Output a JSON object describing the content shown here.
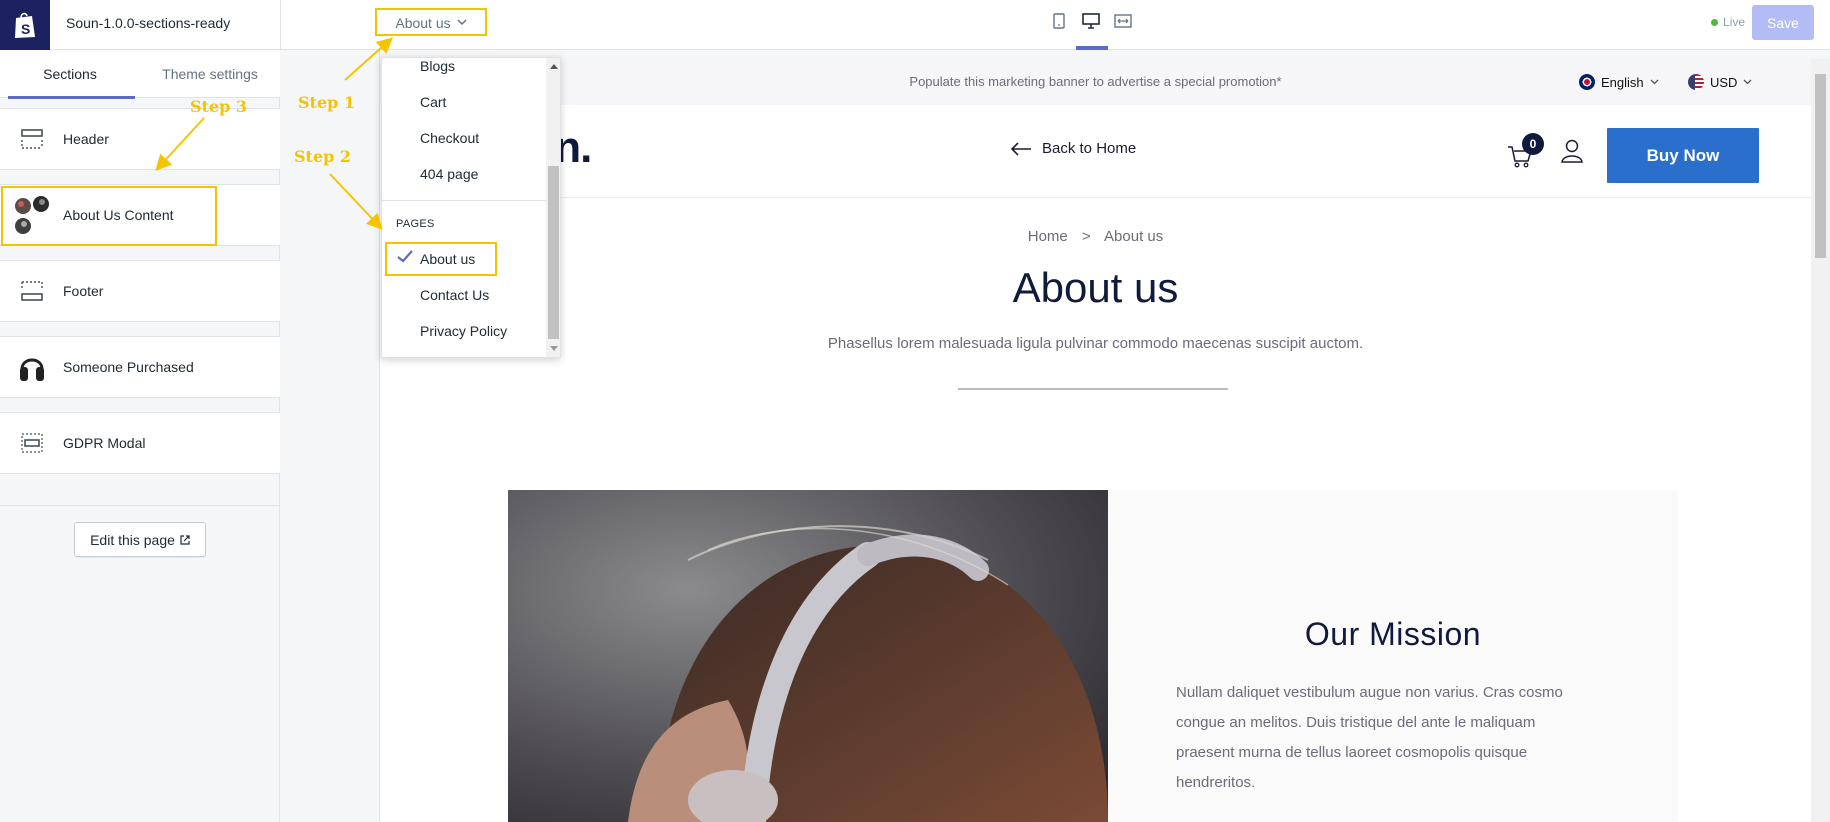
{
  "topbar": {
    "store_name": "Soun-1.0.0-sections-ready",
    "page_select": "About us",
    "live_label": "Live",
    "save_label": "Save"
  },
  "sidebar": {
    "tabs": [
      {
        "label": "Sections",
        "active": true
      },
      {
        "label": "Theme settings",
        "active": false
      }
    ],
    "sections": [
      {
        "label": "Header",
        "icon": "header-layout-icon"
      },
      {
        "label": "About Us Content",
        "icon": "image-thumbnails-icon"
      },
      {
        "label": "Footer",
        "icon": "footer-layout-icon"
      },
      {
        "label": "Someone Purchased",
        "icon": "headphones-icon"
      },
      {
        "label": "GDPR Modal",
        "icon": "modal-layout-icon"
      }
    ],
    "edit_page_label": "Edit this page"
  },
  "dropdown": {
    "items_top": [
      "Blogs",
      "Cart",
      "Checkout",
      "404 page"
    ],
    "pages_heading": "PAGES",
    "pages": [
      "About us",
      "Contact Us",
      "Privacy Policy"
    ],
    "selected": "About us"
  },
  "preview": {
    "promo_text": "Populate this marketing banner to advertise a special promotion*",
    "language": "English",
    "currency": "USD",
    "brand": "soun.",
    "back_home": "Back to Home",
    "cart_count": "0",
    "buy_now": "Buy Now",
    "breadcrumb_home": "Home",
    "breadcrumb_sep": ">",
    "breadcrumb_current": "About us",
    "page_title": "About us",
    "page_subtitle": "Phasellus lorem malesuada ligula pulvinar commodo maecenas suscipit auctom.",
    "mission_title": "Our Mission",
    "mission_lines": [
      "Nullam daliquet vestibulum augue non varius. Cras cosmo",
      "congue an melitos. Duis tristique del ante le maliquam",
      "praesent murna de tellus laoreet cosmopolis quisque",
      "hendreritos."
    ]
  },
  "annotations": {
    "step1": "Step 1",
    "step2": "Step 2",
    "step3": "Step 3"
  },
  "colors": {
    "accent": "#5c6ac4",
    "annotation": "#f5c400",
    "buy_now": "#2a6fcc",
    "brand_dark": "#0f1a3c"
  }
}
